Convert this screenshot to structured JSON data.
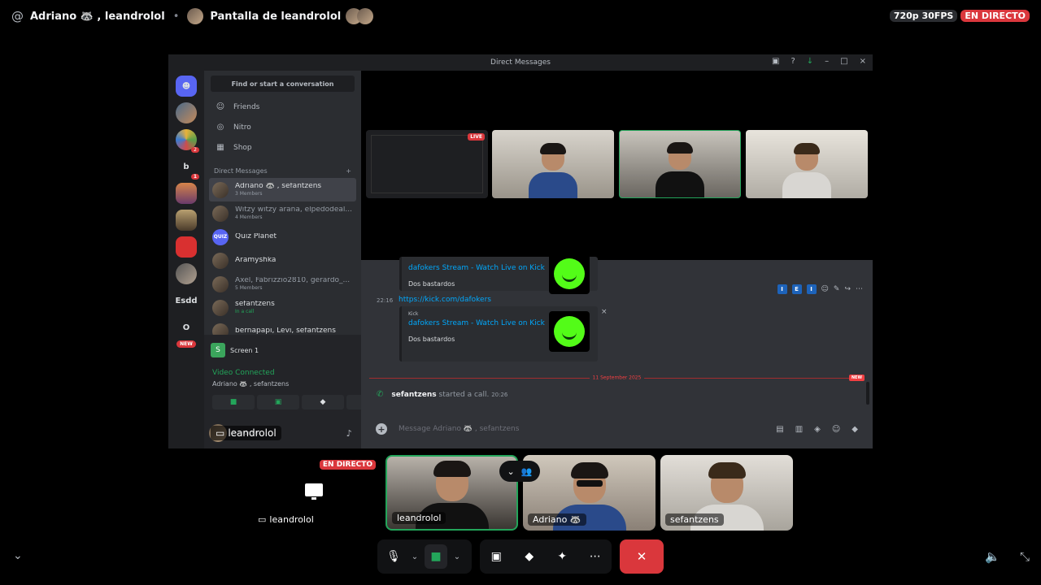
{
  "header": {
    "at_symbol": "@",
    "channel_name": "Adriano 🦝 , leandrolol",
    "separator": "•",
    "stream_title": "Pantalla de leandrolol",
    "quality": "720p 30FPS",
    "live_label": "EN DIRECTO"
  },
  "shared_screen": {
    "window_title": "Direct Messages",
    "find_placeholder": "Find or start a conversation",
    "nav": [
      {
        "label": "Friends",
        "icon": "friends-icon"
      },
      {
        "label": "Nitro",
        "icon": "nitro-icon"
      },
      {
        "label": "Shop",
        "icon": "shop-icon"
      }
    ],
    "dm_header": "Direct Messages",
    "dm_add": "+",
    "guild_letters": {
      "b": "b",
      "esdd": "Esdd",
      "o": "O",
      "new": "NEW"
    },
    "guild_pings": [
      "2",
      "1"
    ],
    "dms": [
      {
        "name": "Adriano 🦝 , sefantzens",
        "sub": "3 Members"
      },
      {
        "name": "Witzy witzy araña, elpedodeal...",
        "sub": "4 Members"
      },
      {
        "name": "Quiz Planet",
        "sub": ""
      },
      {
        "name": "Aramyshka",
        "sub": ""
      },
      {
        "name": "Axel, Fabrizzio2810, gerardo_...",
        "sub": "5 Members"
      },
      {
        "name": "sefantzens",
        "sub": "In a call"
      },
      {
        "name": "bernapapi, Levi, sefantzens",
        "sub": ""
      }
    ],
    "quiz_logo": "QUIZ",
    "screen_share": {
      "label": "Screen 1",
      "icon_letter": "S"
    },
    "voice": {
      "status": "Video Connected",
      "channel": "Adriano 🦝 , sefantzens"
    },
    "user_panel": {
      "name": "leandrolol"
    },
    "overlay_name": "leandrolol",
    "call_tile_live": "LIVE",
    "chat": {
      "embed1": {
        "title": "dafokers Stream - Watch Live on Kick",
        "desc": "Dos bastardos"
      },
      "time": "22:16",
      "link": "https://kick.com/dafokers",
      "embed2": {
        "provider": "Kick",
        "title": "dafokers Stream - Watch Live on Kick",
        "desc": "Dos bastardos"
      },
      "reaction_letters": [
        "I",
        "E",
        "I"
      ],
      "divider_date": "11 September 2025",
      "new_label": "NEW",
      "call_user": "sefantzens",
      "call_text": "started a call.",
      "call_time": "20:26",
      "message_placeholder": "Message Adriano 🦝 , sefantzens"
    }
  },
  "participants": [
    {
      "name": "leandrolol",
      "badge": "EN DIRECTO"
    },
    {
      "name": "leandrolol"
    },
    {
      "name": "Adriano 🦝"
    },
    {
      "name": "sefantzens"
    }
  ],
  "accent": {
    "green": "#23a55a",
    "red": "#da373c",
    "blurple": "#5865f2",
    "link": "#00a8fc"
  }
}
